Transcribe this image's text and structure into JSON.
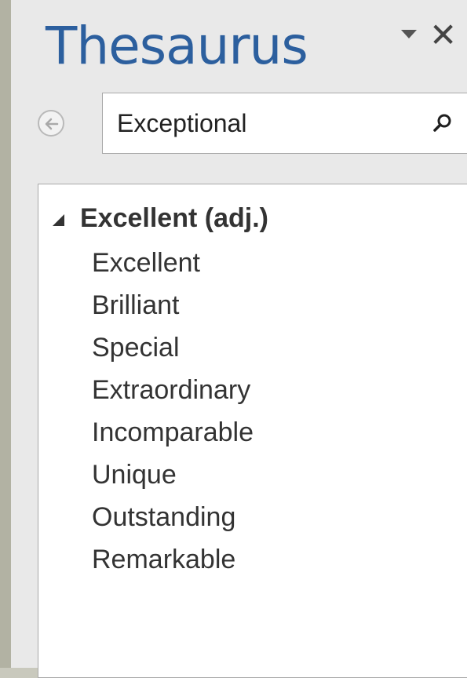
{
  "title": "Thesaurus",
  "search": {
    "value": "Exceptional"
  },
  "results": {
    "group_label": "Excellent (adj.)",
    "items": [
      "Excellent",
      "Brilliant",
      "Special",
      "Extraordinary",
      "Incomparable",
      "Unique",
      "Outstanding",
      "Remarkable"
    ]
  },
  "background_fragment": ")",
  "icons": {
    "dropdown": "chevron-down-icon",
    "close": "close-icon",
    "back": "back-arrow-icon",
    "search": "search-icon",
    "collapse": "collapse-triangle-icon"
  },
  "colors": {
    "title": "#2c5f9e",
    "pane_bg": "#e9e9e9",
    "outer_bg": "#b2b2a3"
  }
}
